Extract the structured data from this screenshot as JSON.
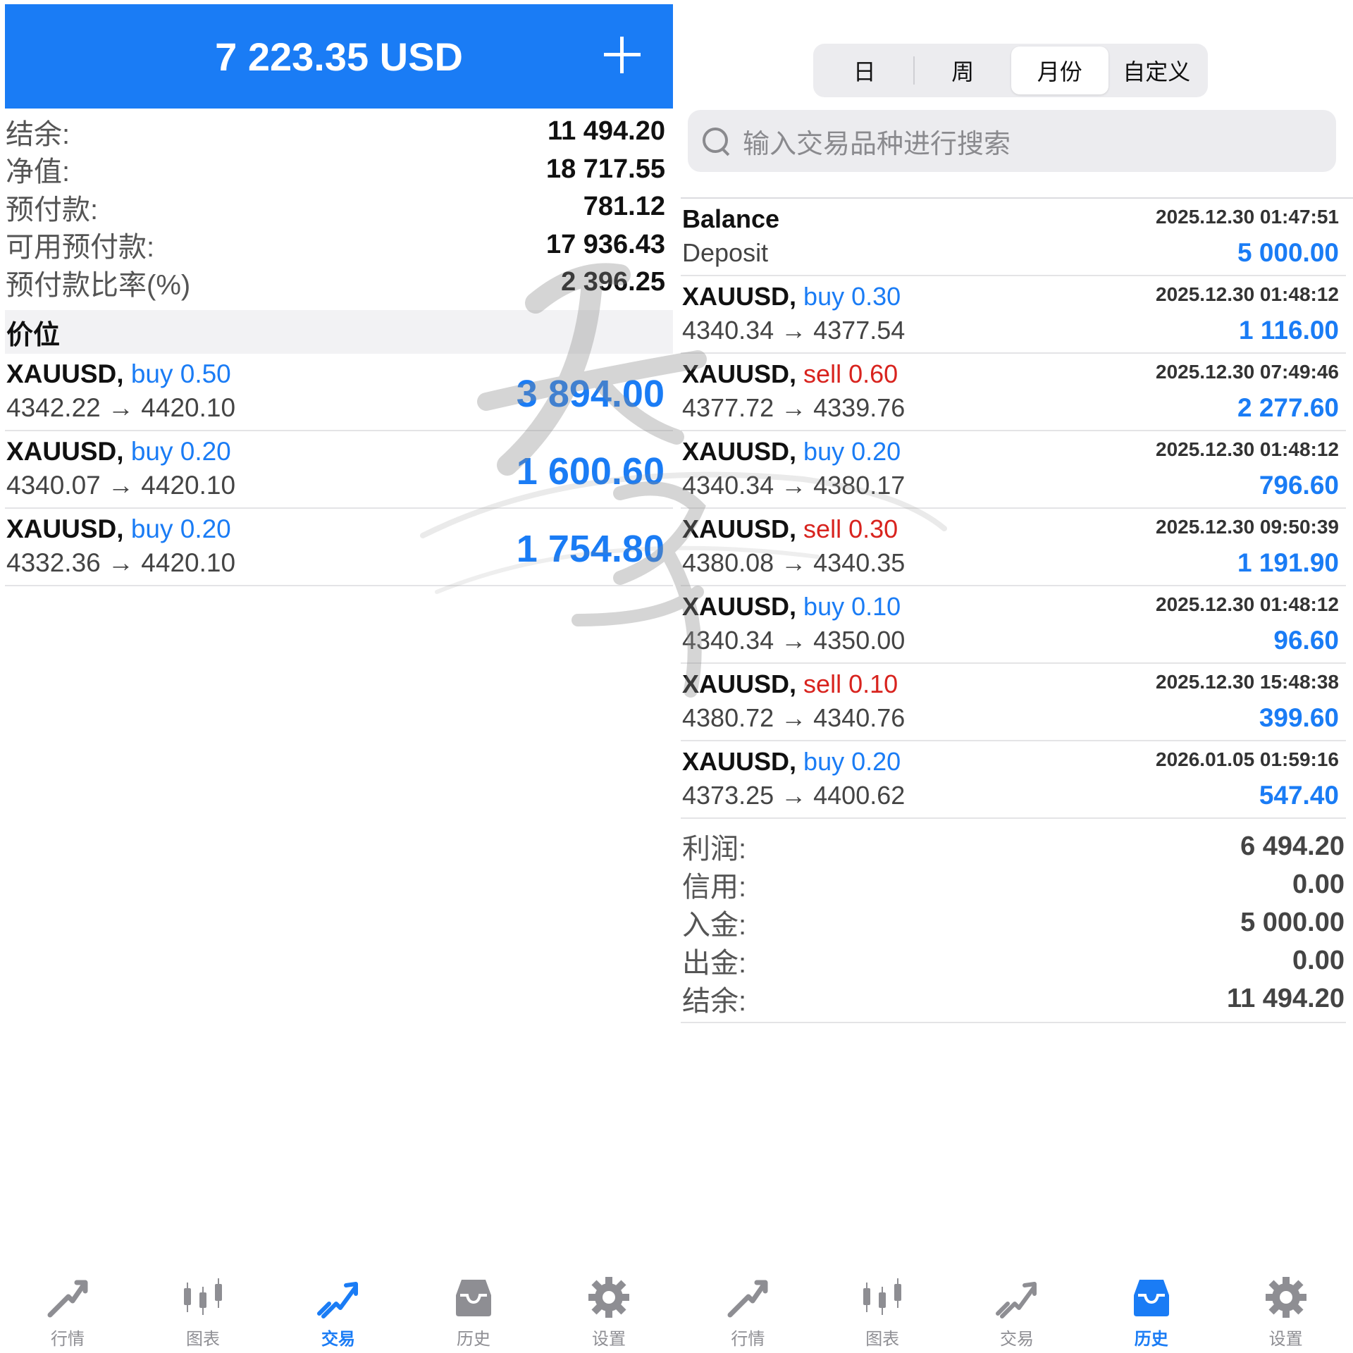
{
  "left": {
    "header": {
      "title": "7 223.35 USD",
      "plus_icon": "plus-icon"
    },
    "summary": [
      {
        "label": "结余:",
        "value": "11 494.20"
      },
      {
        "label": "净值:",
        "value": "18 717.55"
      },
      {
        "label": "预付款:",
        "value": "781.12"
      },
      {
        "label": "可用预付款:",
        "value": "17 936.43"
      },
      {
        "label": "预付款比率(%)",
        "value": "2 396.25"
      }
    ],
    "section_title": "价位",
    "positions": [
      {
        "symbol": "XAUUSD,",
        "side": "buy",
        "volume": "0.50",
        "prices": "4342.22 → 4420.10",
        "profit": "3 894.00"
      },
      {
        "symbol": "XAUUSD,",
        "side": "buy",
        "volume": "0.20",
        "prices": "4340.07 → 4420.10",
        "profit": "1 600.60"
      },
      {
        "symbol": "XAUUSD,",
        "side": "buy",
        "volume": "0.20",
        "prices": "4332.36 → 4420.10",
        "profit": "1 754.80"
      }
    ]
  },
  "right": {
    "segments": [
      {
        "label": "日",
        "active": false
      },
      {
        "label": "周",
        "active": false
      },
      {
        "label": "月份",
        "active": true
      },
      {
        "label": "自定义",
        "active": false
      }
    ],
    "search": {
      "placeholder": "输入交易品种进行搜索",
      "icon": "search-icon"
    },
    "balance_entry": {
      "title": "Balance",
      "subtitle": "Deposit",
      "time": "2025.12.30 01:47:51",
      "amount": "5 000.00"
    },
    "history": [
      {
        "symbol": "XAUUSD,",
        "side": "buy",
        "volume": "0.30",
        "prices": "4340.34 → 4377.54",
        "time": "2025.12.30 01:48:12",
        "profit": "1 116.00"
      },
      {
        "symbol": "XAUUSD,",
        "side": "sell",
        "volume": "0.60",
        "prices": "4377.72 → 4339.76",
        "time": "2025.12.30 07:49:46",
        "profit": "2 277.60"
      },
      {
        "symbol": "XAUUSD,",
        "side": "buy",
        "volume": "0.20",
        "prices": "4340.34 → 4380.17",
        "time": "2025.12.30 01:48:12",
        "profit": "796.60"
      },
      {
        "symbol": "XAUUSD,",
        "side": "sell",
        "volume": "0.30",
        "prices": "4380.08 → 4340.35",
        "time": "2025.12.30 09:50:39",
        "profit": "1 191.90"
      },
      {
        "symbol": "XAUUSD,",
        "side": "buy",
        "volume": "0.10",
        "prices": "4340.34 → 4350.00",
        "time": "2025.12.30 01:48:12",
        "profit": "96.60"
      },
      {
        "symbol": "XAUUSD,",
        "side": "sell",
        "volume": "0.10",
        "prices": "4380.72 → 4340.76",
        "time": "2025.12.30 15:48:38",
        "profit": "399.60"
      },
      {
        "symbol": "XAUUSD,",
        "side": "buy",
        "volume": "0.20",
        "prices": "4373.25 → 4400.62",
        "time": "2026.01.05 01:59:16",
        "profit": "547.40"
      }
    ],
    "totals": [
      {
        "label": "利润:",
        "value": "6 494.20"
      },
      {
        "label": "信用:",
        "value": "0.00"
      },
      {
        "label": "入金:",
        "value": "5 000.00"
      },
      {
        "label": "出金:",
        "value": "0.00"
      },
      {
        "label": "结余:",
        "value": "11 494.20"
      }
    ]
  },
  "tabbar_left": [
    {
      "label": "行情",
      "icon": "quotes-icon",
      "active": false
    },
    {
      "label": "图表",
      "icon": "chart-icon",
      "active": false
    },
    {
      "label": "交易",
      "icon": "trade-icon",
      "active": true
    },
    {
      "label": "历史",
      "icon": "history-icon",
      "active": false
    },
    {
      "label": "设置",
      "icon": "settings-icon",
      "active": false
    }
  ],
  "tabbar_right": [
    {
      "label": "行情",
      "icon": "quotes-icon",
      "active": false
    },
    {
      "label": "图表",
      "icon": "chart-icon",
      "active": false
    },
    {
      "label": "交易",
      "icon": "trade-icon",
      "active": false
    },
    {
      "label": "历史",
      "icon": "history-icon",
      "active": true
    },
    {
      "label": "设置",
      "icon": "settings-icon",
      "active": false
    }
  ],
  "colors": {
    "accent": "#1a7cf5",
    "sell": "#d8231e",
    "inactive": "#8e8e93"
  }
}
